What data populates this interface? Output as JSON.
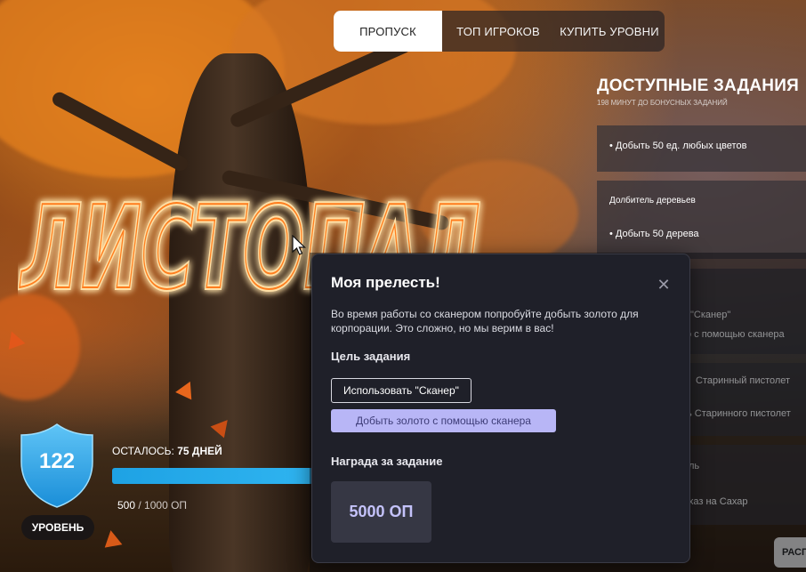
{
  "nav": {
    "tabs": [
      {
        "label": "ПРОПУСК",
        "active": true
      },
      {
        "label": "ТОП ИГРОКОВ",
        "active": false
      },
      {
        "label": "КУПИТЬ УРОВНИ",
        "active": false
      }
    ]
  },
  "event": {
    "logo_text": "ЛИСТОПАД"
  },
  "tasks_panel": {
    "title": "ДОСТУПНЫЕ ЗАДАНИЯ",
    "subtitle": "198 МИНУТ ДО БОНУСНЫХ ЗАДАНИЙ",
    "items": [
      {
        "bullet": "• Добыть 50 ед. любых цветов"
      },
      {
        "header": "Долбитель деревьев",
        "bullet": "• Добыть 50 дерева"
      },
      {
        "bullet": "\"Сканер\""
      },
      {
        "bullet": "о с помощью сканера"
      },
      {
        "bullet": "Старинный пистолет"
      },
      {
        "bullet": "ь Старинного пистолет"
      },
      {
        "bullet": "ль"
      },
      {
        "bullet": "хаз на Сахар"
      }
    ],
    "edge_button": "РАСП"
  },
  "level": {
    "number": "122",
    "label": "УРОВЕНЬ",
    "remaining_prefix": "ОСТАЛОСЬ:",
    "remaining_value": "75 ДНЕЙ",
    "xp_current": "500",
    "xp_total": "/ 1000 ОП",
    "xp_progress": 0.5
  },
  "modal": {
    "title": "Моя прелесть!",
    "close_glyph": "✕",
    "description": "Во время работы со сканером попробуйте добыть золото для корпорации. Это сложно, но мы верим в вас!",
    "goal_heading": "Цель задания",
    "goals": [
      {
        "label": "Использовать \"Сканер\"",
        "state": "done"
      },
      {
        "label": "Добыть золото с помощью сканера",
        "state": "current"
      }
    ],
    "reward_heading": "Награда за задание",
    "reward_value": "5000 ОП"
  },
  "colors": {
    "accent_blue": "#2fb4f0",
    "modal_bg": "#1f2029",
    "goal_current_bg": "#b8b6f6",
    "reward_text": "#c4c2fa",
    "logo_orange": "#ff8a2a"
  },
  "icons": {
    "shield": "shield-icon",
    "close": "close-icon",
    "cursor": "mouse-cursor-icon"
  }
}
